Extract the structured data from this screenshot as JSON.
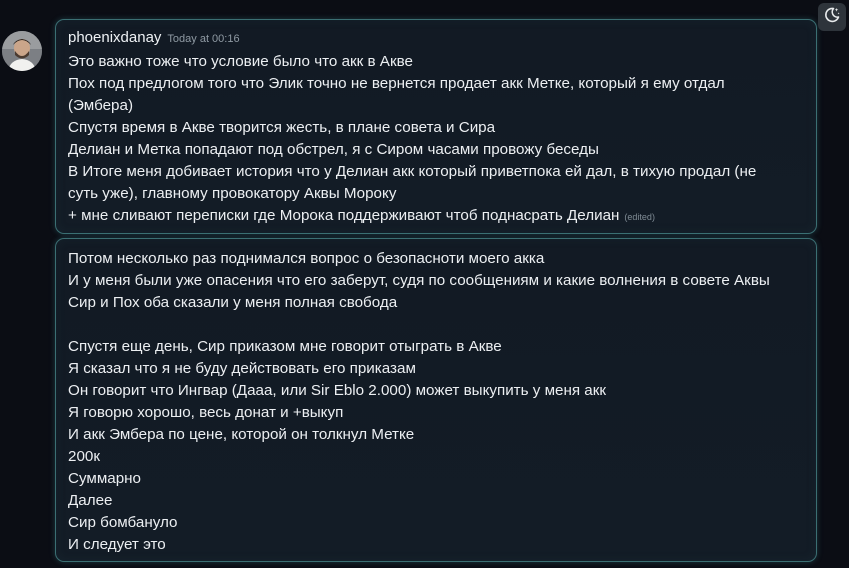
{
  "message": {
    "username": "phoenixdanay",
    "timestamp": "Today at 00:16",
    "edited_label": "(edited)",
    "lines": [
      "Это важно тоже что условие было что акк в Акве",
      "Пох под предлогом того что Элик точно не вернется продает акк Метке, который я ему отдал",
      "(Эмбера)",
      "Спустя время в Акве творится жесть, в плане совета и Сира",
      "Делиан и Метка попадают под обстрел, я с Сиром часами провожу беседы",
      "В Итоге меня добивает история что у Делиан акк который приветпока ей дал, в тихую продал (не",
      "суть уже), главному провокатору Аквы Мороку",
      "+ мне сливают переписки где Морока поддерживают чтоб поднасрать Делиан"
    ]
  },
  "followup": {
    "lines": [
      "Потом несколько раз поднимался вопрос о безопасноти моего акка",
      "И у меня были уже опасения что его заберут, судя по сообщениям и какие волнения в совете Аквы",
      "Сир и Пох оба сказали у меня полная свобода",
      "",
      "Спустя еще день, Сир приказом мне говорит отыграть в Акве",
      "Я сказал что я не буду действовать его приказам",
      "Он говорит что Ингвар (Дааа, или Sir Eblo 2.000) может выкупить у меня акк",
      "Я говорю хорошо, весь донат и +выкуп",
      "И акк Эмбера по цене, которой он толкнул Метке",
      "200к",
      "Суммарно",
      "Далее",
      "Сир бомбануло",
      "И следует это"
    ]
  },
  "toolbar": {
    "theme_toggle_icon": "moon-stars-icon"
  }
}
